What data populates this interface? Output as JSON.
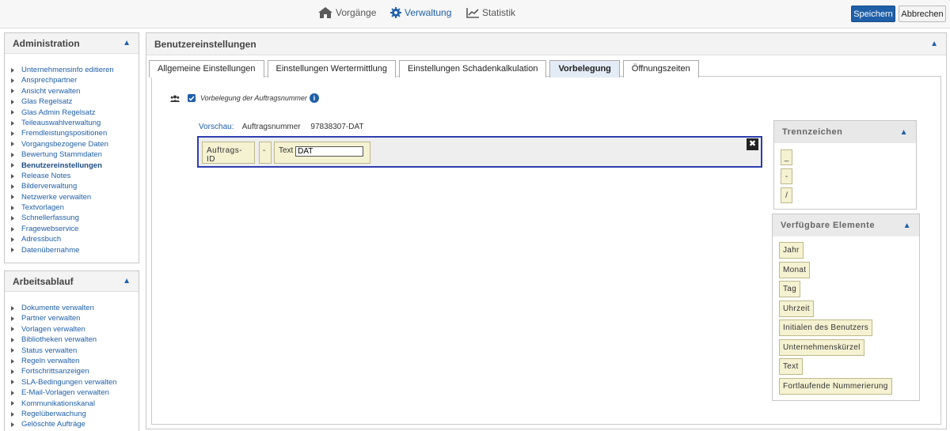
{
  "nav": {
    "items": [
      {
        "label": "Vorgänge",
        "icon": "home-icon"
      },
      {
        "label": "Verwaltung",
        "icon": "gear-icon"
      },
      {
        "label": "Statistik",
        "icon": "chart-icon"
      }
    ],
    "save_label": "Speichern",
    "cancel_label": "Abbrechen"
  },
  "sidebar": {
    "admin": {
      "title": "Administration",
      "items": [
        "Unternehmensinfo editieren",
        "Ansprechpartner",
        "Ansicht verwalten",
        "Glas Regelsatz",
        "Glas Admin Regelsatz",
        "Teileauswahlverwaltung",
        "Fremdleistungspositionen",
        "Vorgangsbezogene Daten",
        "Bewertung Stammdaten",
        "Benutzereinstellungen",
        "Release Notes",
        "Bilderverwaltung",
        "Netzwerke verwalten",
        "Textvorlagen",
        "Schnellerfassung",
        "Fragewebservice",
        "Adressbuch",
        "Datenübernahme"
      ],
      "active_index": 9
    },
    "workflow": {
      "title": "Arbeitsablauf",
      "items": [
        "Dokumente verwalten",
        "Partner verwalten",
        "Vorlagen verwalten",
        "Bibliotheken verwalten",
        "Status verwalten",
        "Regeln verwalten",
        "Fortschrittsanzeigen",
        "SLA-Bedingungen verwalten",
        "E-Mail-Vorlagen verwalten",
        "Kommunikationskanal",
        "Regelüberwachung",
        "Gelöschte Aufträge"
      ]
    }
  },
  "main": {
    "title": "Benutzereinstellungen",
    "tabs": [
      "Allgemeine Einstellungen",
      "Einstellungen Wertermittlung",
      "Einstellungen Schadenkalkulation",
      "Vorbelegung",
      "Öffnungszeiten"
    ],
    "active_tab": 3,
    "option_label": "Vorbelegung der Auftragsnummer",
    "preview_label": "Vorschau:",
    "preview_field": "Auftragsnummer",
    "preview_value": "97838307-DAT",
    "builder": {
      "chip1": "Auftrags-ID",
      "chip2": "-",
      "chip3_label": "Text",
      "chip3_value": "DAT",
      "close": "✖"
    }
  },
  "separators": {
    "title": "Trennzeichen",
    "items": [
      "_",
      "-",
      "/"
    ]
  },
  "elements": {
    "title": "Verfügbare Elemente",
    "items": [
      "Jahr",
      "Monat",
      "Tag",
      "Uhrzeit",
      "Initialen des Benutzers",
      "Unternehmenskürzel",
      "Text",
      "Fortlaufende Nummerierung"
    ]
  }
}
